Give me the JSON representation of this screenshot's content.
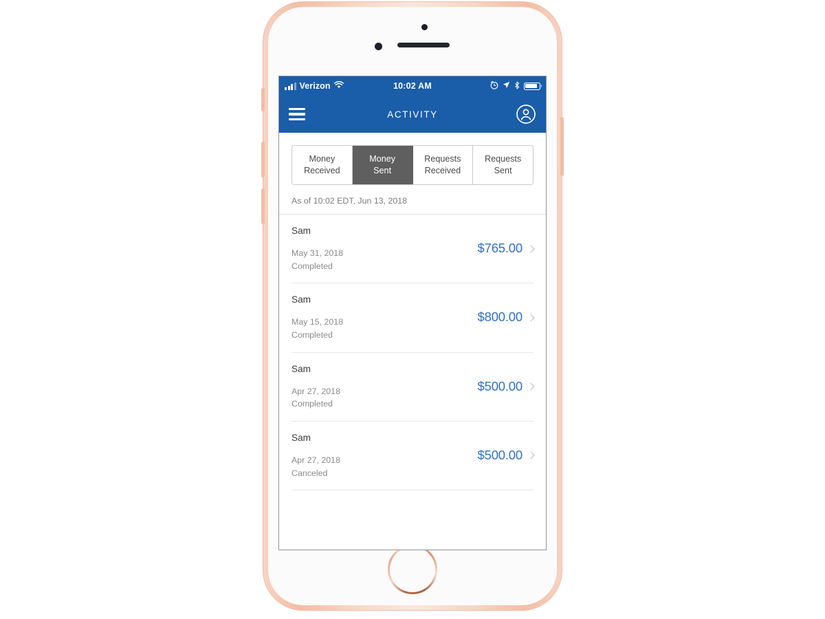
{
  "device": {
    "frame_color": "#f4c3ad",
    "face_color": "#fbfbfb",
    "hardware": {
      "front_camera": "front-camera",
      "sensor": "proximity-sensor",
      "earpiece": "earpiece-speaker",
      "home_button": "home-button",
      "silent_switch": "silent-switch",
      "volume_up": "volume-up-button",
      "volume_down": "volume-down-button",
      "power": "power-button"
    }
  },
  "status_bar": {
    "carrier": "Verizon",
    "time": "10:02 AM",
    "signal_icon": "cellular-signal-icon",
    "wifi_icon": "wifi-icon",
    "alarm_icon": "alarm-clock-icon",
    "location_icon": "location-arrow-icon",
    "bluetooth_icon": "bluetooth-icon",
    "battery_icon": "battery-icon",
    "background": "#1a5da9"
  },
  "nav_bar": {
    "menu_icon": "hamburger-menu-icon",
    "title": "ACTIVITY",
    "profile_icon": "profile-avatar-icon",
    "background": "#1a5da9"
  },
  "tabs": {
    "active_index": 1,
    "active_background": "#5f5f5f",
    "items": [
      {
        "line1": "Money",
        "line2": "Received"
      },
      {
        "line1": "Money",
        "line2": "Sent"
      },
      {
        "line1": "Requests",
        "line2": "Received"
      },
      {
        "line1": "Requests",
        "line2": "Sent"
      }
    ]
  },
  "as_of": "As of 10:02 EDT, Jun 13, 2018",
  "amount_color": "#3071c4",
  "transactions": [
    {
      "name": "Sam",
      "date": "May 31, 2018",
      "status": "Completed",
      "amount": "$765.00"
    },
    {
      "name": "Sam",
      "date": "May 15, 2018",
      "status": "Completed",
      "amount": "$800.00"
    },
    {
      "name": "Sam",
      "date": "Apr 27, 2018",
      "status": "Completed",
      "amount": "$500.00"
    },
    {
      "name": "Sam",
      "date": "Apr 27, 2018",
      "status": "Canceled",
      "amount": "$500.00"
    }
  ]
}
